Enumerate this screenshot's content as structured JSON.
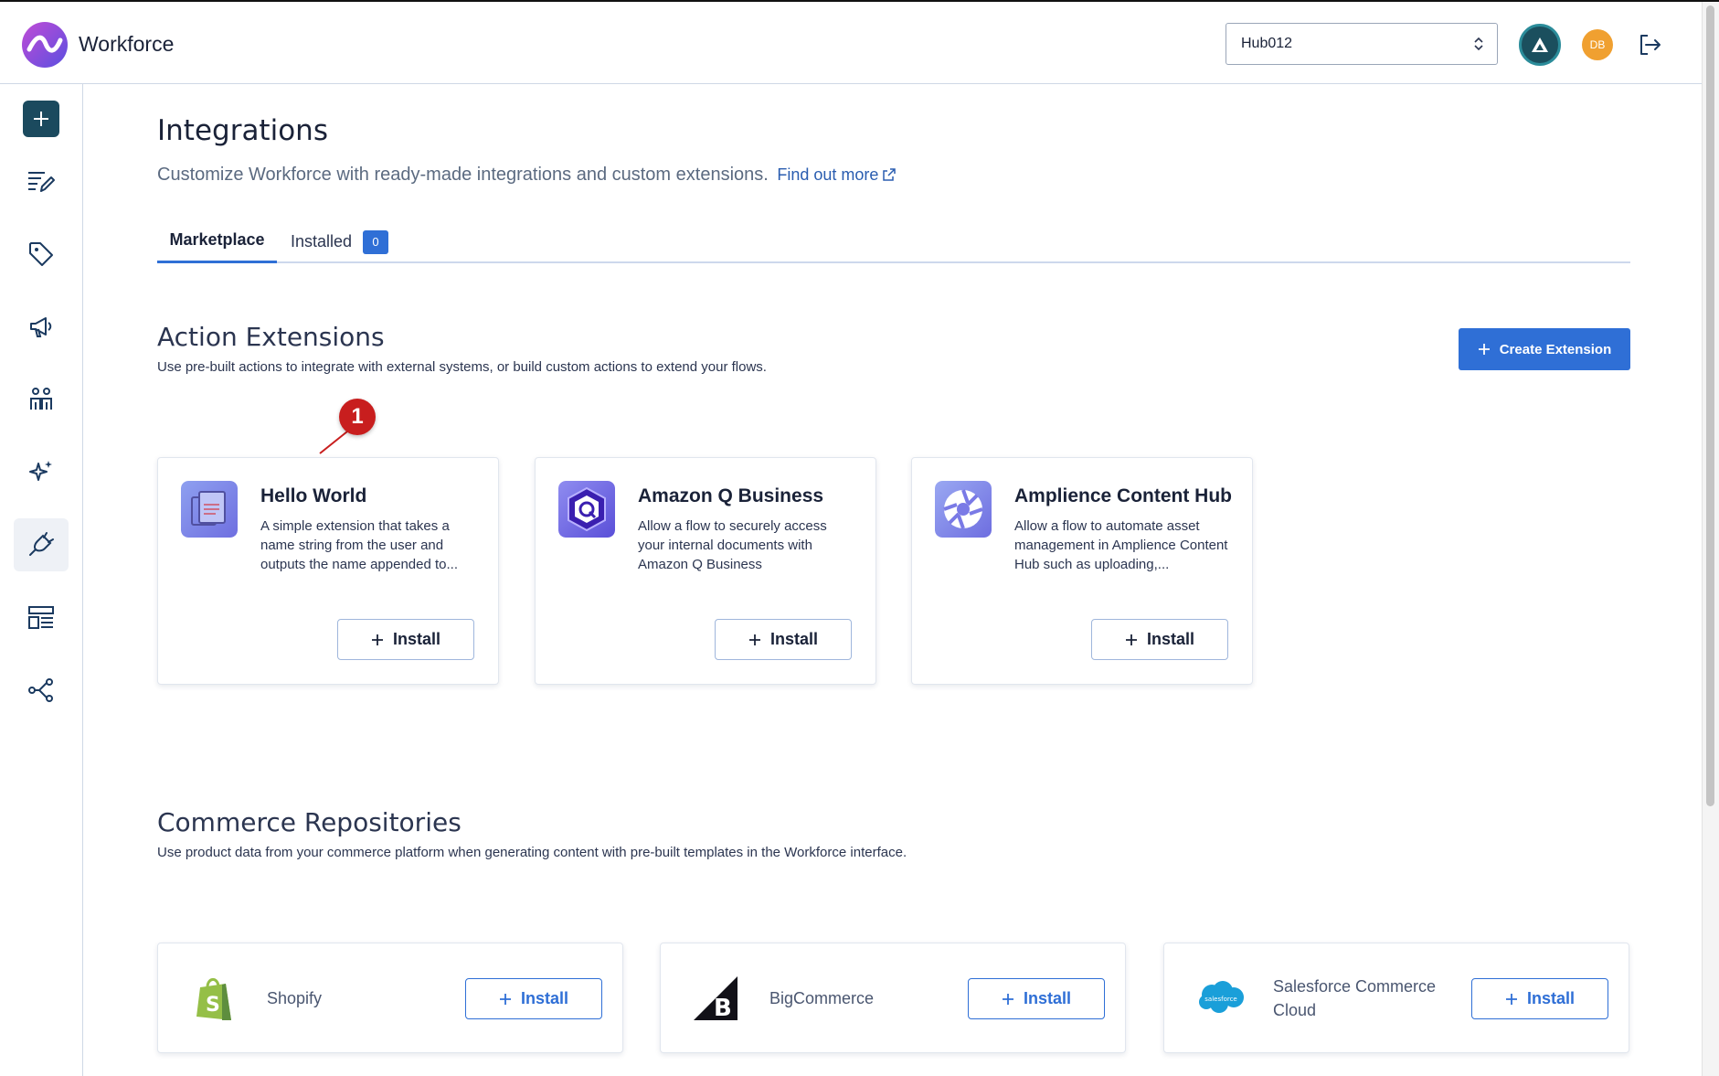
{
  "header": {
    "app_title": "Workforce",
    "hub_selected": "Hub012",
    "avatar_initials": "DB"
  },
  "sidebar": {
    "items": [
      {
        "icon": "plus-icon"
      },
      {
        "icon": "edit-list-icon"
      },
      {
        "icon": "tag-icon"
      },
      {
        "icon": "megaphone-icon"
      },
      {
        "icon": "people-icon"
      },
      {
        "icon": "sparkles-icon"
      },
      {
        "icon": "plug-icon",
        "active": true
      },
      {
        "icon": "layout-icon"
      },
      {
        "icon": "workflow-icon"
      }
    ]
  },
  "page": {
    "title": "Integrations",
    "description": "Customize Workforce with ready-made integrations and custom extensions.",
    "find_out_more": "Find out more"
  },
  "tabs": {
    "marketplace": "Marketplace",
    "installed": "Installed",
    "installed_count": "0"
  },
  "action_extensions": {
    "title": "Action Extensions",
    "description": "Use pre-built actions to integrate with external systems, or build custom actions to extend your flows.",
    "create_button": "Create Extension",
    "marker": "1",
    "cards": [
      {
        "title": "Hello World",
        "description": "A simple extension that takes a name string from the user and outputs the name appended to...",
        "install": "Install"
      },
      {
        "title": "Amazon Q Business",
        "description": "Allow a flow to securely access your internal documents with Amazon Q Business",
        "install": "Install"
      },
      {
        "title": "Amplience Content Hub",
        "description": "Allow a flow to automate asset management in Amplience Content Hub such as uploading,...",
        "install": "Install"
      }
    ]
  },
  "commerce": {
    "title": "Commerce Repositories",
    "description": "Use product data from your commerce platform when generating content with pre-built templates in the Workforce interface.",
    "cards": [
      {
        "name": "Shopify",
        "install": "Install"
      },
      {
        "name": "BigCommerce",
        "install": "Install"
      },
      {
        "name": "Salesforce Commerce Cloud",
        "install": "Install"
      }
    ],
    "salesforce_logo_text": "salesforce"
  },
  "colors": {
    "primary": "#2f6fd6",
    "sidebar_plus": "#1b4a5e",
    "marker": "#c81e1e",
    "avatar": "#f0a030"
  }
}
